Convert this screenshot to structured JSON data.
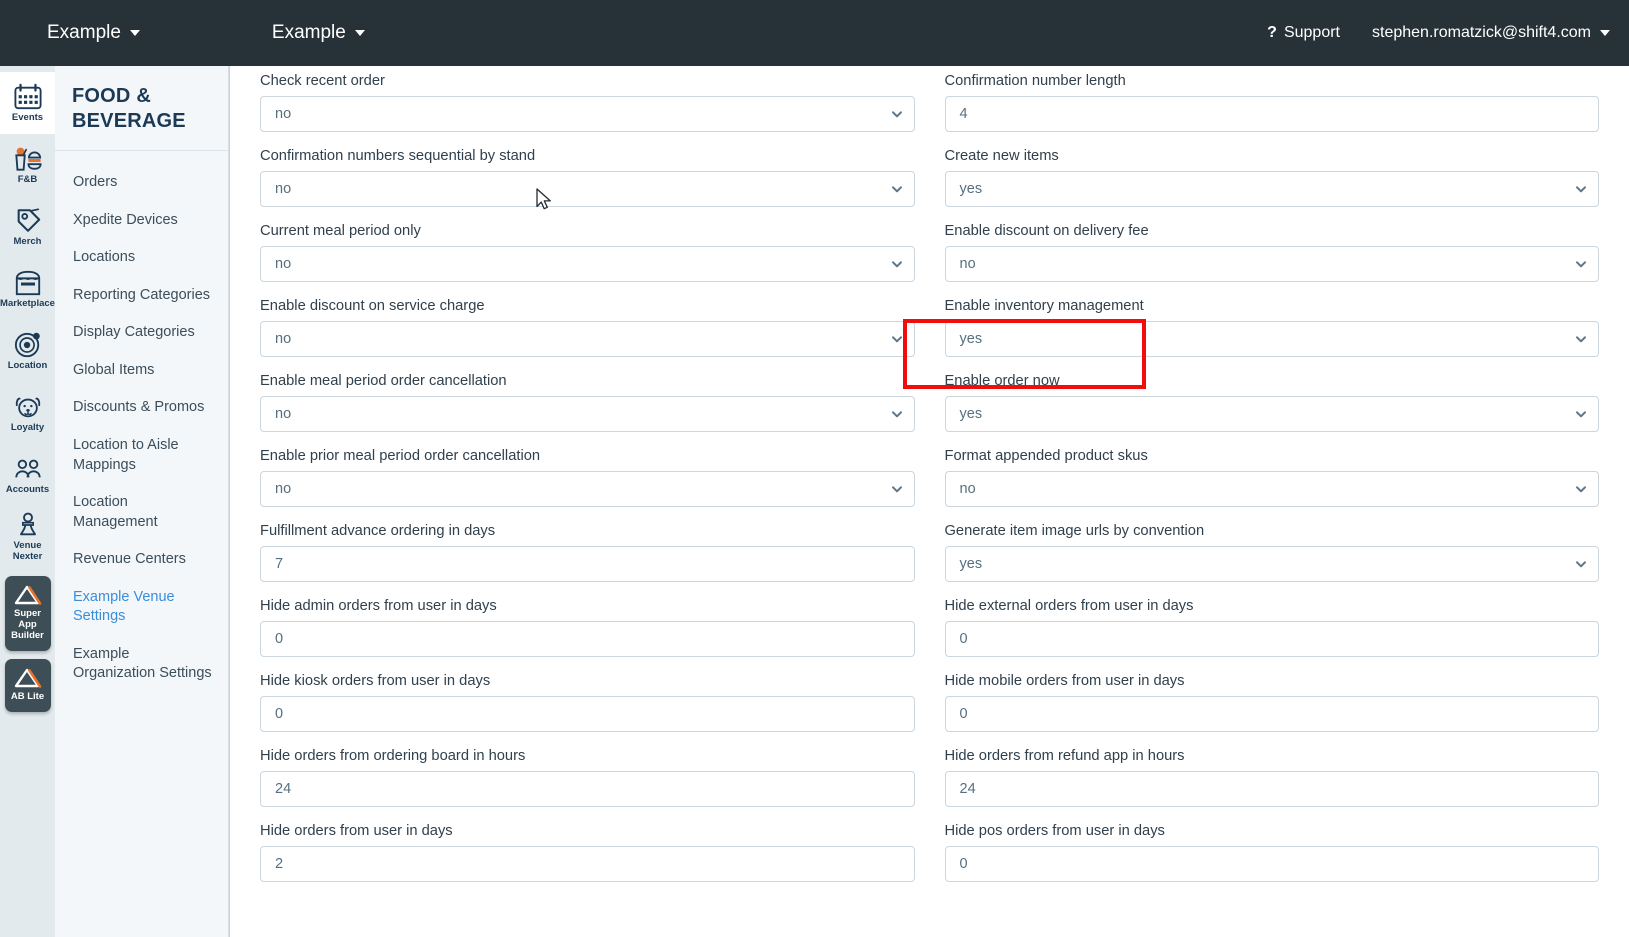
{
  "topbar": {
    "menu1": "Example",
    "menu2": "Example",
    "support": "Support",
    "support_icon": "question-mark-icon",
    "user_email": "stephen.romatzick@shift4.com",
    "background": "#273238"
  },
  "rail": {
    "items": [
      {
        "label": "Events",
        "icon": "calendar-icon",
        "active": true
      },
      {
        "label": "F&B",
        "icon": "food-beverage-icon",
        "active": false
      },
      {
        "label": "Merch",
        "icon": "price-tag-icon",
        "active": false
      },
      {
        "label": "Marketplace",
        "icon": "storefront-icon",
        "active": false
      },
      {
        "label": "Location",
        "icon": "location-radar-icon",
        "active": false
      },
      {
        "label": "Loyalty",
        "icon": "dog-face-icon",
        "active": false
      },
      {
        "label": "Accounts",
        "icon": "people-group-icon",
        "active": false
      },
      {
        "label": "Venue Nexter",
        "icon": "chess-pawn-icon",
        "active": false
      }
    ],
    "buttons": [
      {
        "label": "Super App Builder",
        "icon": "triangle-logo-icon"
      },
      {
        "label": "AB Lite",
        "icon": "triangle-logo-icon"
      }
    ]
  },
  "subnav": {
    "title": "FOOD & BEVERAGE",
    "items": [
      {
        "label": "Orders",
        "active": false
      },
      {
        "label": "Xpedite Devices",
        "active": false
      },
      {
        "label": "Locations",
        "active": false
      },
      {
        "label": "Reporting Categories",
        "active": false
      },
      {
        "label": "Display Categories",
        "active": false
      },
      {
        "label": "Global Items",
        "active": false
      },
      {
        "label": "Discounts & Promos",
        "active": false
      },
      {
        "label": "Location to Aisle Mappings",
        "active": false
      },
      {
        "label": "Location Management",
        "active": false
      },
      {
        "label": "Revenue Centers",
        "active": false
      },
      {
        "label": "Example Venue Settings",
        "active": true
      },
      {
        "label": "Example Organization Settings",
        "active": false
      }
    ]
  },
  "form": {
    "left": [
      {
        "label": "",
        "value": "",
        "type": "text",
        "cut_top": true
      },
      {
        "label": "Check recent order",
        "value": "no",
        "type": "select"
      },
      {
        "label": "Confirmation numbers sequential by stand",
        "value": "no",
        "type": "select"
      },
      {
        "label": "Current meal period only",
        "value": "no",
        "type": "select"
      },
      {
        "label": "Enable discount on service charge",
        "value": "no",
        "type": "select"
      },
      {
        "label": "Enable meal period order cancellation",
        "value": "no",
        "type": "select"
      },
      {
        "label": "Enable prior meal period order cancellation",
        "value": "no",
        "type": "select"
      },
      {
        "label": "Fulfillment advance ordering in days",
        "value": "7",
        "type": "text"
      },
      {
        "label": "Hide admin orders from user in days",
        "value": "0",
        "type": "text"
      },
      {
        "label": "Hide kiosk orders from user in days",
        "value": "0",
        "type": "text"
      },
      {
        "label": "Hide orders from ordering board in hours",
        "value": "24",
        "type": "text"
      },
      {
        "label": "Hide orders from user in days",
        "value": "2",
        "type": "text"
      }
    ],
    "right": [
      {
        "label": "",
        "value": "",
        "type": "text",
        "cut_top": true
      },
      {
        "label": "Confirmation number length",
        "value": "4",
        "type": "text"
      },
      {
        "label": "Create new items",
        "value": "yes",
        "type": "select"
      },
      {
        "label": "Enable discount on delivery fee",
        "value": "no",
        "type": "select"
      },
      {
        "label": "Enable inventory management",
        "value": "yes",
        "type": "select",
        "highlighted": true
      },
      {
        "label": "Enable order now",
        "value": "yes",
        "type": "select"
      },
      {
        "label": "Format appended product skus",
        "value": "no",
        "type": "select"
      },
      {
        "label": "Generate item image urls by convention",
        "value": "yes",
        "type": "select"
      },
      {
        "label": "Hide external orders from user in days",
        "value": "0",
        "type": "text"
      },
      {
        "label": "Hide mobile orders from user in days",
        "value": "0",
        "type": "text"
      },
      {
        "label": "Hide orders from refund app in hours",
        "value": "24",
        "type": "text"
      },
      {
        "label": "Hide pos orders from user in days",
        "value": "0",
        "type": "text"
      }
    ]
  },
  "annotation": {
    "highlight_color": "#f20d0d",
    "highlight_target": "Enable inventory management"
  }
}
